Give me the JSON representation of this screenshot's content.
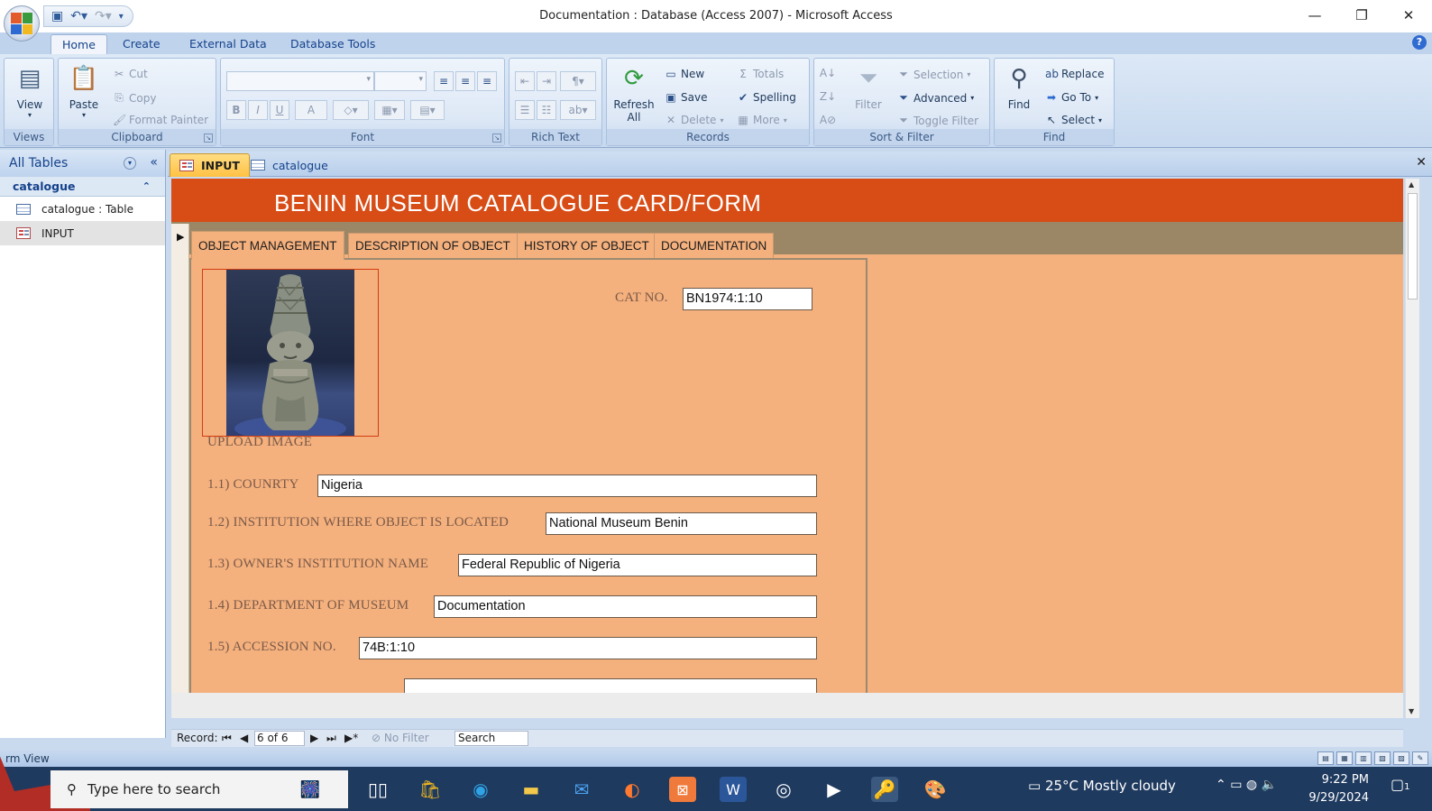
{
  "window": {
    "title": "Documentation : Database (Access 2007) - Microsoft Access",
    "controls": [
      "—",
      "❐",
      "✕"
    ]
  },
  "ribbon_tabs": [
    "Home",
    "Create",
    "External Data",
    "Database Tools"
  ],
  "ribbon": {
    "views": {
      "label": "Views",
      "view": "View"
    },
    "clipboard": {
      "label": "Clipboard",
      "paste": "Paste",
      "cut": "Cut",
      "copy": "Copy",
      "format_painter": "Format Painter"
    },
    "font": {
      "label": "Font",
      "bold": "B",
      "italic": "I",
      "underline": "U",
      "font_color": "A"
    },
    "rich_text": {
      "label": "Rich Text"
    },
    "records": {
      "label": "Records",
      "refresh": "Refresh",
      "refresh_sub": "All",
      "new": "New",
      "save": "Save",
      "delete": "Delete",
      "totals": "Totals",
      "spelling": "Spelling",
      "more": "More"
    },
    "sort_filter": {
      "label": "Sort & Filter",
      "filter": "Filter",
      "selection": "Selection",
      "advanced": "Advanced",
      "toggle_filter": "Toggle Filter"
    },
    "find": {
      "label": "Find",
      "find": "Find",
      "replace": "Replace",
      "goto": "Go To",
      "select": "Select"
    }
  },
  "nav": {
    "header": "All Tables",
    "group": "catalogue",
    "items": [
      {
        "label": "catalogue : Table",
        "type": "table"
      },
      {
        "label": "INPUT",
        "type": "form"
      }
    ]
  },
  "doc_tabs": [
    "INPUT",
    "catalogue"
  ],
  "form": {
    "title": "BENIN MUSEUM CATALOGUE  CARD/FORM",
    "tabs": [
      "OBJECT MANAGEMENT",
      "DESCRIPTION OF OBJECT",
      "HISTORY OF OBJECT",
      "DOCUMENTATION"
    ],
    "cat_no_label": "CAT NO.",
    "cat_no_value": "BN1974:1:10",
    "upload_label": "UPLOAD IMAGE",
    "fields": [
      {
        "label": "1.1) COUNRTY",
        "value": "Nigeria"
      },
      {
        "label": "1.2) INSTITUTION WHERE OBJECT IS LOCATED",
        "value": "National Museum Benin"
      },
      {
        "label": "1.3) OWNER'S INSTITUTION NAME",
        "value": "Federal Republic of Nigeria"
      },
      {
        "label": "1.4) DEPARTMENT OF MUSEUM",
        "value": "Documentation"
      },
      {
        "label": "1.5) ACCESSION NO.",
        "value": "74B:1:10"
      }
    ]
  },
  "record_nav": {
    "label": "Record:",
    "position": "6 of 6",
    "filter": "No Filter",
    "search": "Search"
  },
  "status": {
    "text": "rm View"
  },
  "taskbar": {
    "search_placeholder": "Type here to search",
    "weather": "25°C  Mostly cloudy",
    "time": "9:22 PM",
    "date": "9/29/2024",
    "notification_count": "1"
  },
  "colors": {
    "form_header": "#d84c16",
    "form_background": "#f4b07d",
    "tab_strip": "#9b8766",
    "active_doc_tab": "#ffc144"
  }
}
